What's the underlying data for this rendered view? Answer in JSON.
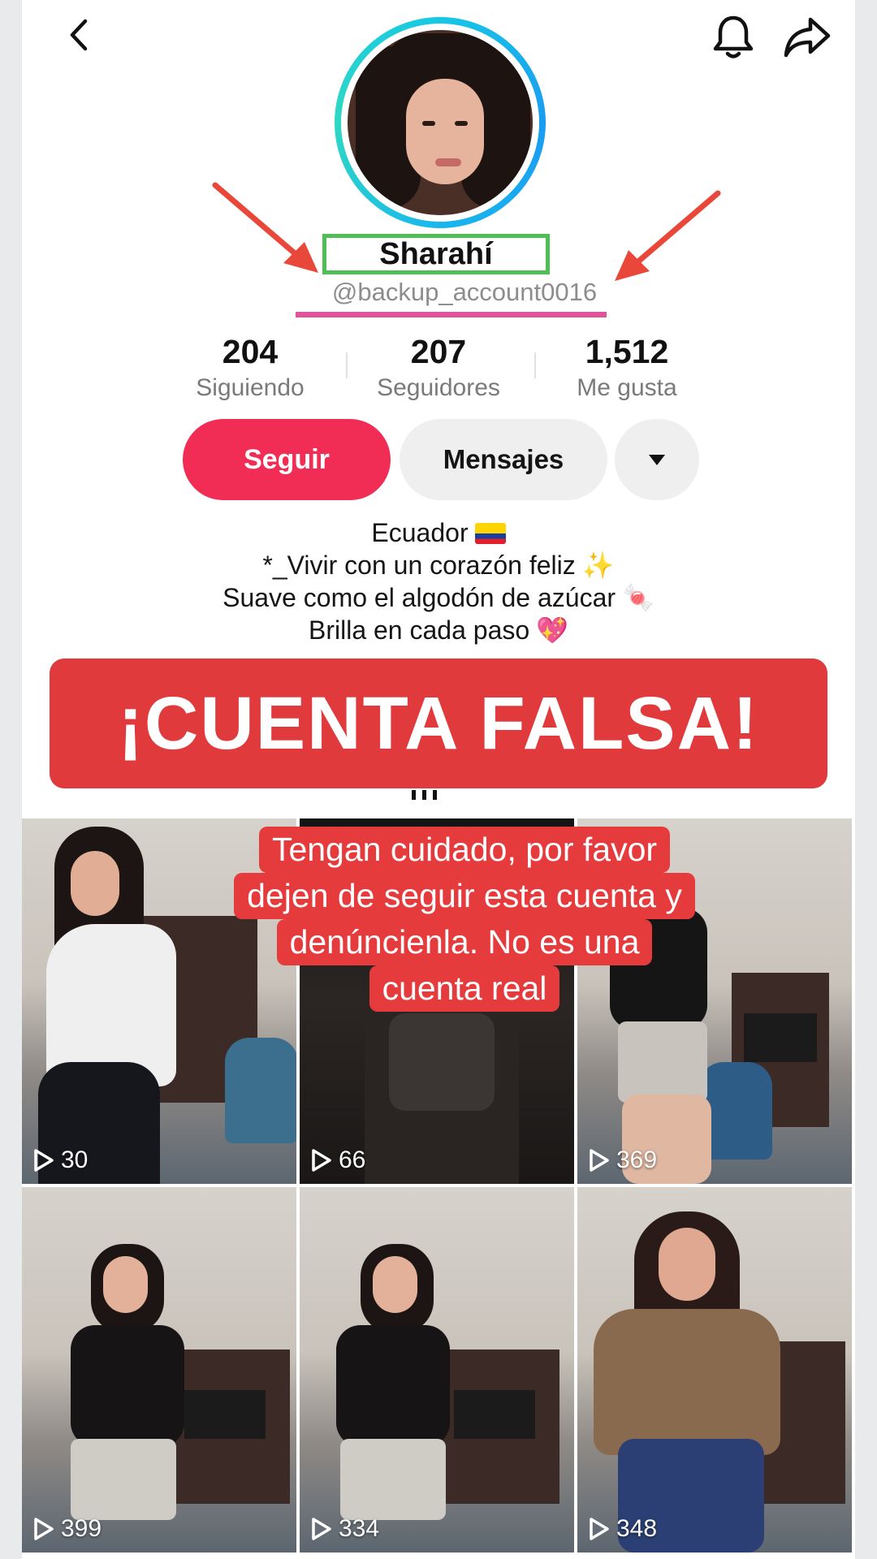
{
  "header": {
    "back_icon": "chevron-left-icon",
    "bell_icon": "bell-icon",
    "share_icon": "share-arrow-icon"
  },
  "profile": {
    "display_name": "Sharahí",
    "username": "@backup_account0016"
  },
  "stats": [
    {
      "value": "204",
      "label": "Siguiendo"
    },
    {
      "value": "207",
      "label": "Seguidores"
    },
    {
      "value": "1,512",
      "label": "Me gusta"
    }
  ],
  "actions": {
    "follow_label": "Seguir",
    "message_label": "Mensajes",
    "more_icon": "caret-down-icon"
  },
  "bio": {
    "line1": "Ecuador",
    "line2": "*_Vivir con un corazón feliz",
    "line3": "Suave como el algodón de azúcar",
    "line4": "Brilla en cada paso"
  },
  "banner": {
    "text": "¡CUENTA FALSA!"
  },
  "warning": {
    "line1": "Tengan cuidado, por favor",
    "line2": "dejen de seguir esta cuenta y",
    "line3": "denúncienla. No es una",
    "line4": "cuenta real"
  },
  "videos": [
    {
      "views": "30"
    },
    {
      "views": "66"
    },
    {
      "views": "369"
    },
    {
      "views": "399"
    },
    {
      "views": "334"
    },
    {
      "views": "348"
    }
  ],
  "colors": {
    "follow_button": "#f12d55",
    "banner": "#e03a3c",
    "name_box": "#4ebe55",
    "username_underline": "#e0559a",
    "arrows": "#e8473a",
    "avatar_ring": "#16c8e6"
  }
}
